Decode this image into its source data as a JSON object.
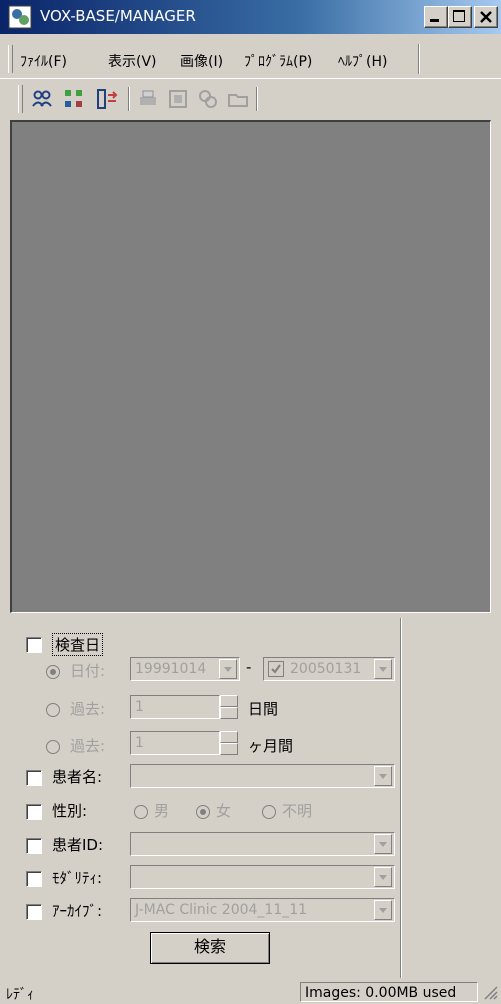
{
  "window": {
    "title": "VOX-BASE/MANAGER"
  },
  "menu": [
    "ﾌｧｲﾙ(F)",
    "表示(V)",
    "画像(I)",
    "ﾌﾟﾛｸﾞﾗﾑ(P)",
    "ﾍﾙﾌﾟ(H)"
  ],
  "toolbar": {
    "icons": [
      "patient-list-icon",
      "series-icon",
      "transfer-icon",
      "print-icon",
      "film-icon",
      "network-icon",
      "folder-icon"
    ]
  },
  "search": {
    "exam_date_label": "検査日",
    "date_label": "日付:",
    "date_from": "19991014",
    "dash": "-",
    "date_to": "20050131",
    "past_label": "過去:",
    "past_days_value": "1",
    "days_unit": "日間",
    "past_months_value": "1",
    "months_unit": "ヶ月間",
    "patient_name_label": "患者名:",
    "sex_label": "性別:",
    "sex_options": [
      "男",
      "女",
      "不明"
    ],
    "sex_selected": "女",
    "patient_id_label": "患者ID:",
    "modality_label": "ﾓﾀﾞﾘﾃｨ:",
    "archive_label": "ｱｰｶｲﾌﾞ:",
    "archive_value": "J-MAC Clinic 2004_11_11",
    "search_button": "検索"
  },
  "status": {
    "left": "ﾚﾃﾞｨ",
    "right": "Images: 0.00MB used"
  },
  "colors": {
    "titlebar_start": "#0a246a",
    "titlebar_end": "#a6caf0",
    "image_bg": "#808080",
    "face": "#d4d0c8"
  }
}
